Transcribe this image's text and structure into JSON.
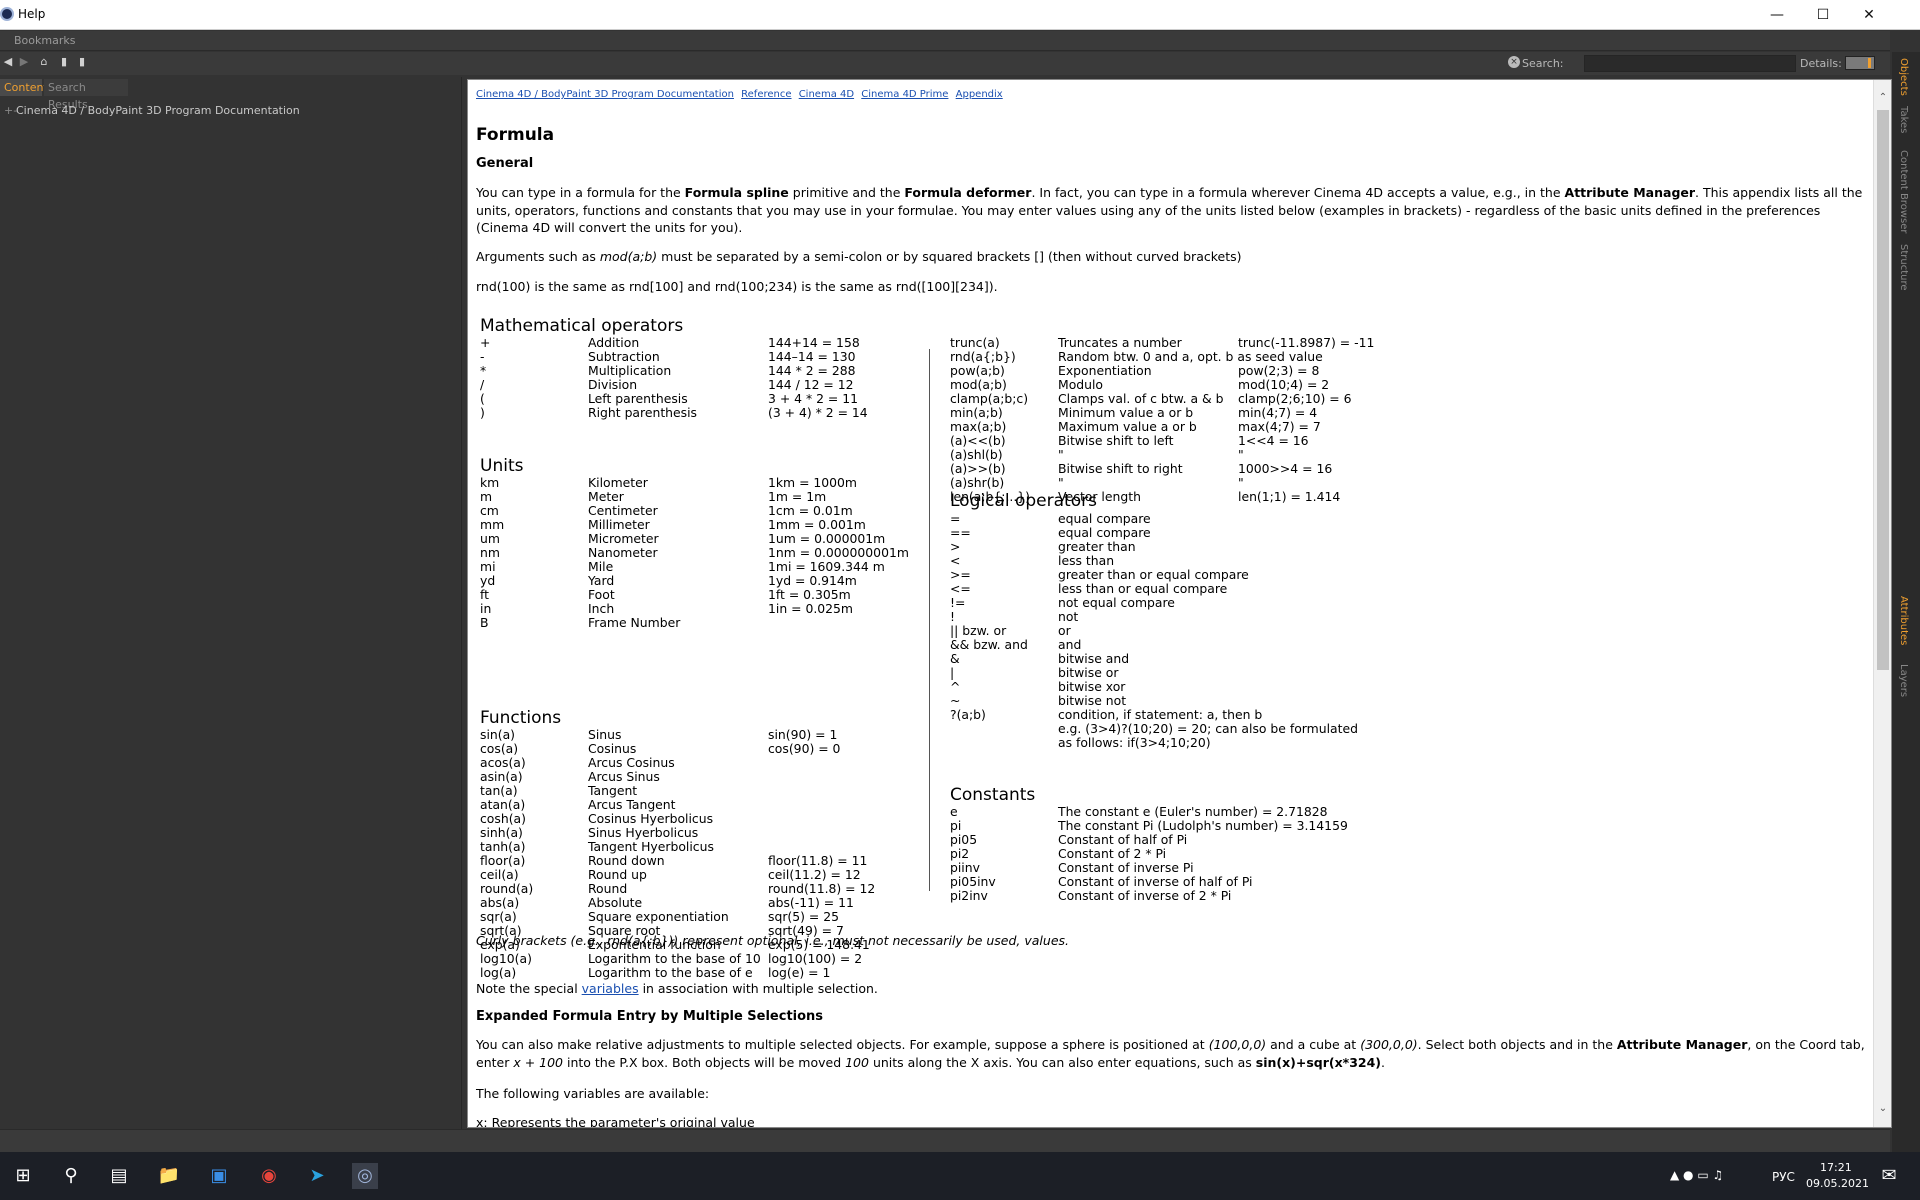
{
  "window": {
    "title": "Help"
  },
  "bookmarks": {
    "label": "Bookmarks"
  },
  "toolbar": {
    "search_label": "Search:",
    "search_value": "",
    "details_label": "Details:"
  },
  "left_tabs": [
    {
      "label": "Content"
    },
    {
      "label": "Search Results"
    }
  ],
  "tree": {
    "root": "Cinema 4D / BodyPaint 3D Program Documentation"
  },
  "right_tabs": [
    "Objects",
    "Takes",
    "Content Browser",
    "Structure",
    "Attributes",
    "Layers"
  ],
  "breadcrumb": [
    "Cinema 4D / BodyPaint 3D Program Documentation",
    "Reference",
    "Cinema 4D",
    "Cinema 4D Prime",
    "Appendix"
  ],
  "doc": {
    "title": "Formula",
    "general_heading": "General",
    "p1a": "You can type in a formula for the ",
    "p1b": "Formula spline",
    "p1c": " primitive and the ",
    "p1d": "Formula deformer",
    "p1e": ". In fact, you can type in a formula wherever Cinema 4D accepts a value, e.g., in the ",
    "p1f": "Attribute Manager",
    "p1g": ". This appendix lists all the units, operators, functions and constants that you may use in your formulae. You may enter values using any of the units listed below (examples in brackets) - regardless of the basic units defined in the preferences (Cinema 4D will convert the units for you).",
    "p2a": "Arguments such as ",
    "p2b": "mod(a;b)",
    "p2c": " must be separated by a semi-colon or by squared brackets [] (then without curved brackets)",
    "p3": "rnd(100) is the same as rnd[100] and rnd(100;234) is the same as rnd([100][234]).",
    "math_heading": "Mathematical operators",
    "math_ops": [
      [
        "+",
        "Addition",
        "144+14 = 158"
      ],
      [
        "-",
        "Subtraction",
        "144–14 = 130"
      ],
      [
        "*",
        "Multiplication",
        "144 * 2 = 288"
      ],
      [
        "/",
        "Division",
        "144 / 12 = 12"
      ],
      [
        "(",
        "Left parenthesis",
        "3 + 4 * 2 = 11"
      ],
      [
        ")",
        "Right parenthesis",
        "(3 + 4) * 2 = 14"
      ]
    ],
    "units_heading": "Units",
    "units": [
      [
        "km",
        "Kilometer",
        "1km = 1000m"
      ],
      [
        "m",
        "Meter",
        "1m = 1m"
      ],
      [
        "cm",
        "Centimeter",
        "1cm = 0.01m"
      ],
      [
        "mm",
        "Millimeter",
        "1mm = 0.001m"
      ],
      [
        "um",
        "Micrometer",
        "1um = 0.000001m"
      ],
      [
        "nm",
        "Nanometer",
        "1nm = 0.000000001m"
      ],
      [
        "mi",
        "Mile",
        "1mi = 1609.344 m"
      ],
      [
        "yd",
        "Yard",
        "1yd = 0.914m"
      ],
      [
        "ft",
        "Foot",
        "1ft = 0.305m"
      ],
      [
        "in",
        "Inch",
        "1in = 0.025m"
      ],
      [
        "B",
        "Frame Number",
        ""
      ]
    ],
    "functions_heading": "Functions",
    "functions": [
      [
        "sin(a)",
        "Sinus",
        "sin(90) = 1"
      ],
      [
        "cos(a)",
        "Cosinus",
        "cos(90) = 0"
      ],
      [
        "acos(a)",
        "Arcus Cosinus",
        ""
      ],
      [
        "asin(a)",
        "Arcus Sinus",
        ""
      ],
      [
        "tan(a)",
        "Tangent",
        ""
      ],
      [
        "atan(a)",
        "Arcus Tangent",
        ""
      ],
      [
        "cosh(a)",
        "Cosinus Hyerbolicus",
        ""
      ],
      [
        "sinh(a)",
        "Sinus Hyerbolicus",
        ""
      ],
      [
        "tanh(a)",
        "Tangent Hyerbolicus",
        ""
      ],
      [
        "floor(a)",
        "Round down",
        "floor(11.8) = 11"
      ],
      [
        "ceil(a)",
        "Round up",
        "ceil(11.2) = 12"
      ],
      [
        "round(a)",
        "Round",
        "round(11.8) = 12"
      ],
      [
        "abs(a)",
        "Absolute",
        "abs(-11) = 11"
      ],
      [
        "sqr(a)",
        "Square exponentiation",
        "sqr(5) = 25"
      ],
      [
        "sqrt(a)",
        "Square root",
        "sqrt(49) = 7"
      ],
      [
        "exp(a)",
        "Expontential function",
        "exp(5) = 148.41"
      ],
      [
        "log10(a)",
        "Logarithm to the base of 10",
        "log10(100) = 2"
      ],
      [
        "log(a)",
        "Logarithm to the base of e",
        "log(e) = 1"
      ]
    ],
    "more_functions": [
      [
        "trunc(a)",
        "Truncates a number",
        "trunc(-11.8987) = -11"
      ],
      [
        "rnd(a{;b})",
        "Random btw. 0 and a, opt. b as seed value",
        ""
      ],
      [
        "pow(a;b)",
        "Exponentiation",
        "pow(2;3) = 8"
      ],
      [
        "mod(a;b)",
        "Modulo",
        "mod(10;4) = 2"
      ],
      [
        "clamp(a;b;c)",
        "Clamps val. of c btw. a & b",
        "clamp(2;6;10) = 6"
      ],
      [
        "min(a;b)",
        "Minimum value a or b",
        "min(4;7) = 4"
      ],
      [
        "max(a;b)",
        "Maximum value a or b",
        "max(4;7) = 7"
      ],
      [
        "(a)<<(b)",
        "Bitwise shift to left",
        "1<<4 = 16"
      ],
      [
        "(a)shl(b)",
        "\"",
        "\""
      ],
      [
        "(a)>>(b)",
        "Bitwise shift to right",
        "1000>>4 = 16"
      ],
      [
        "(a)shr(b)",
        "\"",
        "\""
      ],
      [
        "len(a;b{;...})",
        "Vector length",
        "len(1;1) = 1.414"
      ]
    ],
    "logical_heading": "Logical operators",
    "logical": [
      [
        "=",
        "equal compare"
      ],
      [
        "==",
        "equal compare"
      ],
      [
        ">",
        "greater than"
      ],
      [
        "<",
        "less than"
      ],
      [
        ">=",
        "greater than or equal compare"
      ],
      [
        "<=",
        "less than or equal compare"
      ],
      [
        "!=",
        "not equal compare"
      ],
      [
        "!",
        "not"
      ],
      [
        "|| bzw. or",
        "or"
      ],
      [
        "&& bzw. and",
        "and"
      ],
      [
        "&",
        "bitwise and"
      ],
      [
        " |",
        "bitwise or"
      ],
      [
        "^",
        "bitwise xor"
      ],
      [
        "~",
        "bitwise not"
      ],
      [
        "?(a;b)",
        "condition, if statement:  a, then b"
      ],
      [
        "",
        "e.g. (3>4)?(10;20) = 20; can also be formulated"
      ],
      [
        "",
        "as follows: if(3>4;10;20)"
      ]
    ],
    "constants_heading": "Constants",
    "constants": [
      [
        "e",
        "The constant e (Euler's number)  = 2.71828"
      ],
      [
        "pi",
        "The constant Pi (Ludolph's number)  = 3.14159"
      ],
      [
        "pi05",
        "Constant of half of Pi"
      ],
      [
        "pi2",
        "Constant of 2 * Pi"
      ],
      [
        "piinv",
        "Constant of inverse Pi"
      ],
      [
        "pi05inv",
        "Constant of inverse of half of Pi"
      ],
      [
        "pi2inv",
        "Constant of inverse of 2 * Pi"
      ]
    ],
    "curly_note": "Curly brackets (e.g., rnd(a{;b})) represent optional, i.e., must not necessarily be used, values.",
    "note_a": "Note the special ",
    "note_link": "variables",
    "note_b": " in association with multiple selection.",
    "expanded_heading": "Expanded Formula Entry by Multiple Selections",
    "p4a": "You can also make relative adjustments to multiple selected objects. For example, suppose a sphere is positioned at ",
    "p4b": "(100,0,0)",
    "p4c": " and a cube at ",
    "p4d": "(300,0,0)",
    "p4e": ". Select both objects and in the ",
    "p4f": "Attribute Manager",
    "p4g": ", on the Coord tab, enter ",
    "p4h": "x + 100",
    "p4i": " into the P.X box. Both objects will be moved ",
    "p4j": "100",
    "p4k": " units along the X axis. You can also enter equations, such as ",
    "p4l": "sin(x)+sqr(x*324)",
    "p4m": ".",
    "p5": "The following variables are available:",
    "p6": "x: Represents the parameter's original value"
  },
  "tray": {
    "lang": "РУС",
    "time": "17:21",
    "date": "09.05.2021"
  }
}
